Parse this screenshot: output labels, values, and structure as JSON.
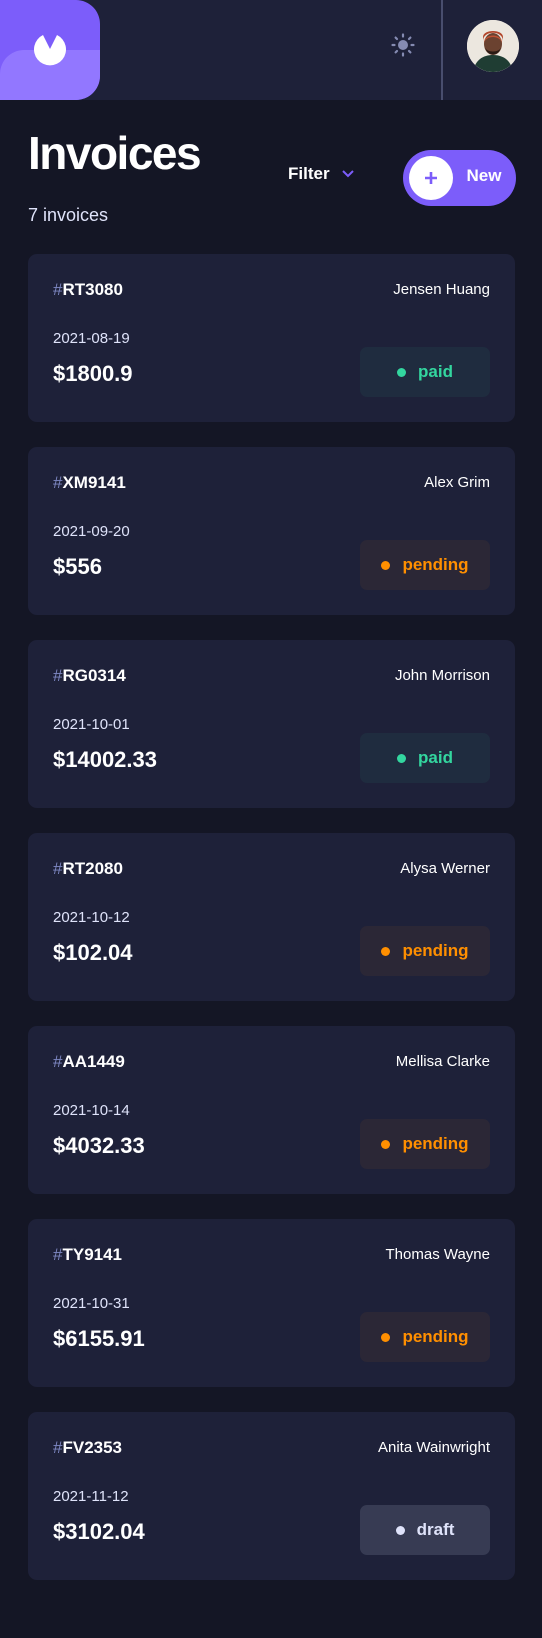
{
  "header": {
    "logo_icon": "app-logo-icon",
    "theme_icon": "sun-icon",
    "avatar_icon": "user-avatar"
  },
  "page": {
    "title": "Invoices",
    "count_text": "7 invoices",
    "filter_label": "Filter",
    "new_label": "New"
  },
  "colors": {
    "accent": "#7C5DFA",
    "paid": "#33D69F",
    "pending": "#FF8F00",
    "draft": "#DFE3FA",
    "background": "#141625",
    "card": "#1E2139"
  },
  "invoices": [
    {
      "id": "RT3080",
      "client": "Jensen Huang",
      "due": "2021-08-19",
      "amount": "$1800.9",
      "status": "paid"
    },
    {
      "id": "XM9141",
      "client": "Alex Grim",
      "due": "2021-09-20",
      "amount": "$556",
      "status": "pending"
    },
    {
      "id": "RG0314",
      "client": "John Morrison",
      "due": "2021-10-01",
      "amount": "$14002.33",
      "status": "paid"
    },
    {
      "id": "RT2080",
      "client": "Alysa Werner",
      "due": "2021-10-12",
      "amount": "$102.04",
      "status": "pending"
    },
    {
      "id": "AA1449",
      "client": "Mellisa Clarke",
      "due": "2021-10-14",
      "amount": "$4032.33",
      "status": "pending"
    },
    {
      "id": "TY9141",
      "client": "Thomas Wayne",
      "due": "2021-10-31",
      "amount": "$6155.91",
      "status": "pending"
    },
    {
      "id": "FV2353",
      "client": "Anita Wainwright",
      "due": "2021-11-12",
      "amount": "$3102.04",
      "status": "draft"
    }
  ]
}
